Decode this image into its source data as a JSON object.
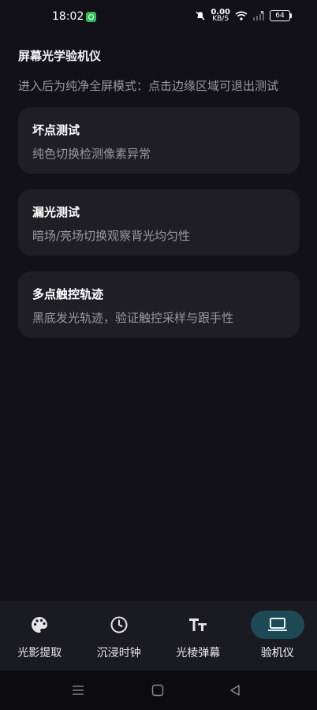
{
  "status": {
    "time": "18:02",
    "speed_value": "0.00",
    "speed_unit": "KB/S",
    "battery": "64"
  },
  "header": {
    "title": "屏幕光学验机仪",
    "subtitle": "进入后为纯净全屏模式：点击边缘区域可退出测试"
  },
  "cards": [
    {
      "title": "坏点测试",
      "desc": "纯色切换检测像素异常"
    },
    {
      "title": "漏光测试",
      "desc": "暗场/亮场切换观察背光均匀性"
    },
    {
      "title": "多点触控轨迹",
      "desc": "黑底发光轨迹，验证触控采样与跟手性"
    }
  ],
  "nav": {
    "items": [
      {
        "label": "光影提取",
        "icon": "palette-icon"
      },
      {
        "label": "沉浸时钟",
        "icon": "clock-icon"
      },
      {
        "label": "光棱弹幕",
        "icon": "text-size-icon"
      },
      {
        "label": "验机仪",
        "icon": "laptop-icon",
        "active": true
      }
    ],
    "active_color": "#1e4a55"
  }
}
